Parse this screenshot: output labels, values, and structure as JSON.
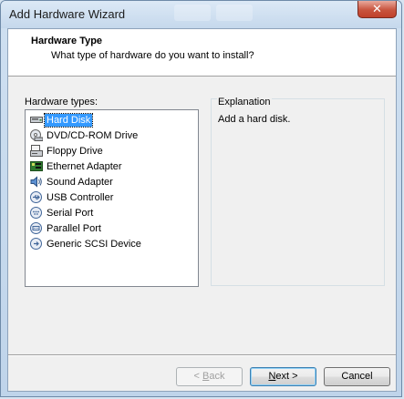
{
  "window": {
    "title": "Add Hardware Wizard",
    "close_glyph": "✕"
  },
  "header": {
    "title": "Hardware Type",
    "subtitle": "What type of hardware do you want to install?"
  },
  "hardware_list": {
    "label": "Hardware types:",
    "selected_index": 0,
    "items": [
      {
        "label": "Hard Disk",
        "icon": "hard-disk-icon",
        "selected": true
      },
      {
        "label": "DVD/CD-ROM Drive",
        "icon": "dvd-drive-icon",
        "selected": false
      },
      {
        "label": "Floppy Drive",
        "icon": "floppy-drive-icon",
        "selected": false
      },
      {
        "label": "Ethernet Adapter",
        "icon": "ethernet-adapter-icon",
        "selected": false
      },
      {
        "label": "Sound Adapter",
        "icon": "sound-adapter-icon",
        "selected": false
      },
      {
        "label": "USB Controller",
        "icon": "usb-controller-icon",
        "selected": false
      },
      {
        "label": "Serial Port",
        "icon": "serial-port-icon",
        "selected": false
      },
      {
        "label": "Parallel Port",
        "icon": "parallel-port-icon",
        "selected": false
      },
      {
        "label": "Generic SCSI Device",
        "icon": "scsi-device-icon",
        "selected": false
      }
    ]
  },
  "explanation": {
    "title": "Explanation",
    "text": "Add a hard disk."
  },
  "buttons": {
    "back": {
      "prefix": "< ",
      "mnemonic": "B",
      "rest": "ack",
      "enabled": false
    },
    "next": {
      "mnemonic": "N",
      "rest": "ext >",
      "enabled": true
    },
    "cancel": {
      "label": "Cancel",
      "enabled": true
    }
  },
  "colors": {
    "selection": "#3399ff",
    "dialog_bg": "#f0f0f0",
    "titlebar": "#c5d8ec",
    "close_button": "#c8543e"
  }
}
